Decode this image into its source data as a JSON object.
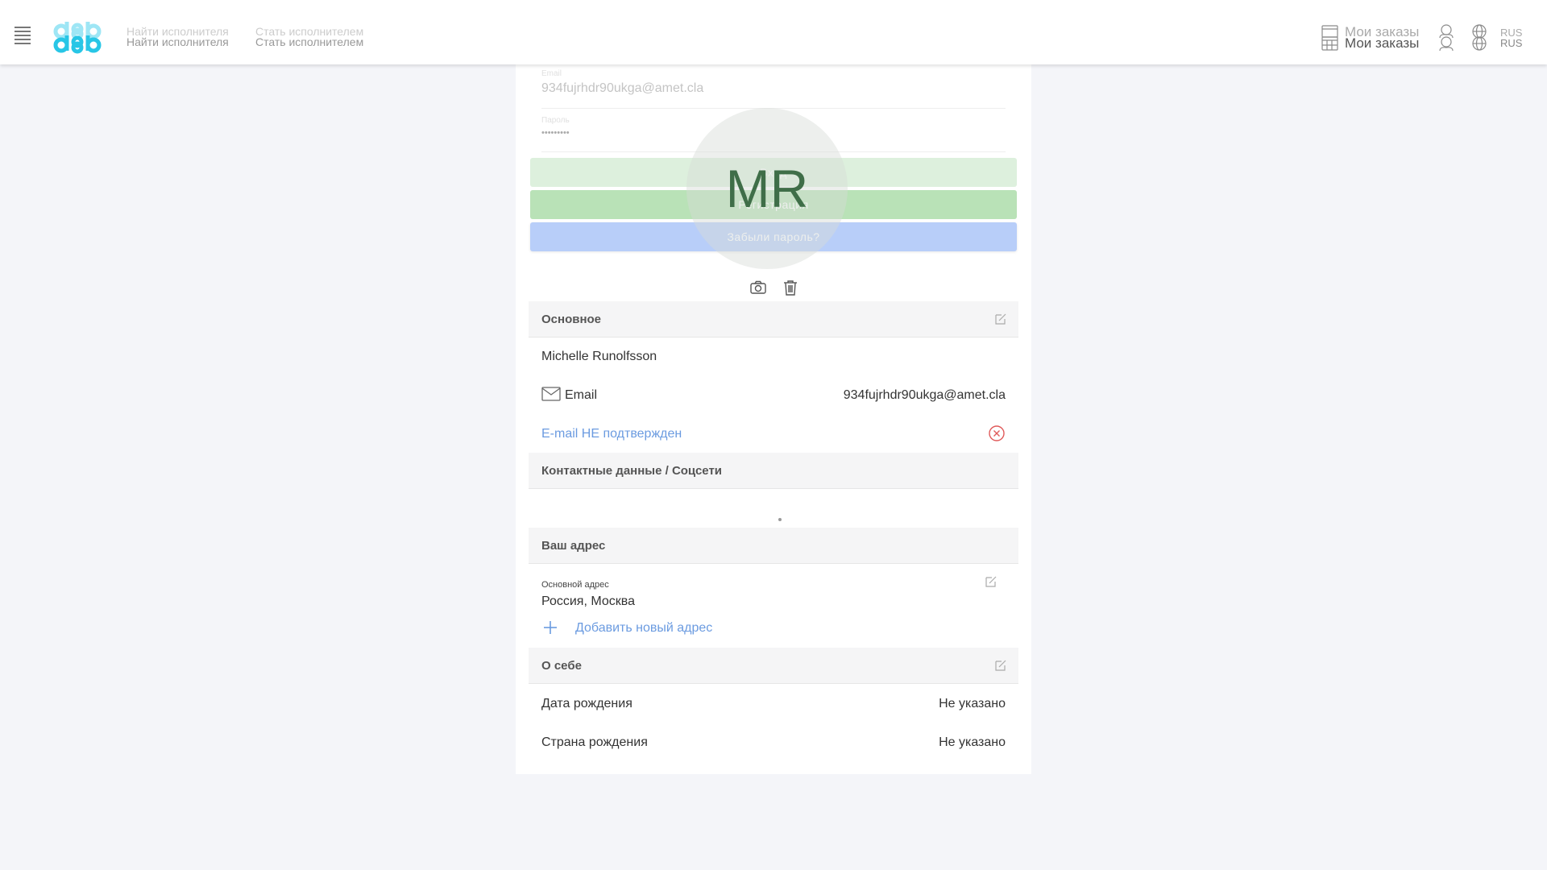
{
  "header": {
    "nav_find": "Найти исполнителя",
    "nav_become": "Стать исполнителем",
    "orders_label": "Мои заказы",
    "lang_label": "RUS"
  },
  "login_overlay": {
    "email_label": "Email",
    "email_value": "934fujrhdr90ukga@amet.cla",
    "password_label": "Пароль",
    "password_value": "•••••••••",
    "login_button": "Вход",
    "register_button": "Регистрация",
    "forgot_button": "Забыли пароль?"
  },
  "avatar": {
    "initials": "MR"
  },
  "basic": {
    "title": "Основное",
    "name": "Michelle Runolfsson",
    "email_label": "Email",
    "email_value": "934fujrhdr90ukga@amet.cla",
    "email_status": "E-mail НЕ подтвержден"
  },
  "contacts": {
    "title": "Контактные данные / Соцсети"
  },
  "address": {
    "title": "Ваш адрес",
    "main_label": "Основной адрес",
    "main_value": "Россия, Москва",
    "add_label": "Добавить новый адрес"
  },
  "about": {
    "title": "О себе",
    "birth_date_label": "Дата рождения",
    "birth_date_value": "Не указано",
    "birth_country_label": "Страна рождения",
    "birth_country_value": "Не указано"
  },
  "colors": {
    "accent_blue": "#6b9be0",
    "logo_cyan": "#28c6e6",
    "error_red": "#e05a5a"
  }
}
